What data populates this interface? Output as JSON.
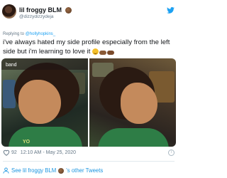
{
  "tweet": {
    "display_name": "lil froggy  BLM",
    "handle": "@dizzydizzydeja",
    "reply_prefix": "Replying to ",
    "reply_to": "@hollyhopkins_",
    "text": "i've always hated my side profile especially from the left side but i'm learning to love it",
    "media_overlay_text": "band",
    "shirt_text": "YO",
    "like_count": "92",
    "timestamp": "12:10 AM - May 25, 2020",
    "see_other_prefix": "See lil froggy  BLM",
    "see_other_suffix": "'s other Tweets"
  },
  "icons": {
    "brand": "twitter-bird-icon",
    "like": "heart-icon",
    "info": "info-icon",
    "profile": "person-icon",
    "emoji": [
      "raised-fist-emoji",
      "smiling-face-emoji",
      "pointing-hands-emoji"
    ]
  },
  "colors": {
    "link": "#1da1f2",
    "secondary_text": "#657786",
    "brand": "#1da1f2"
  }
}
